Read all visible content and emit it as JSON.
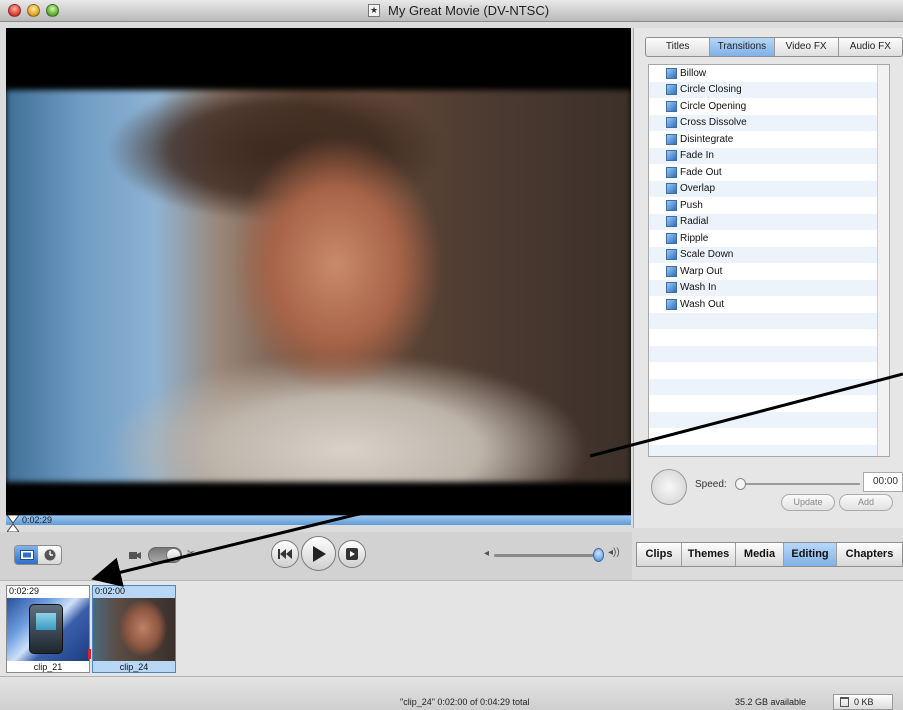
{
  "window": {
    "title": "My Great Movie (DV-NTSC)"
  },
  "viewer": {
    "playhead_time": "0:02:29"
  },
  "effects_panel": {
    "tabs": [
      {
        "label": "Titles",
        "selected": false
      },
      {
        "label": "Transitions",
        "selected": true
      },
      {
        "label": "Video FX",
        "selected": false
      },
      {
        "label": "Audio FX",
        "selected": false
      }
    ],
    "transitions": [
      "Billow",
      "Circle Closing",
      "Circle Opening",
      "Cross Dissolve",
      "Disintegrate",
      "Fade In",
      "Fade Out",
      "Overlap",
      "Push",
      "Radial",
      "Ripple",
      "Scale Down",
      "Warp Out",
      "Wash In",
      "Wash Out"
    ],
    "speed_label": "Speed:",
    "speed_value": "00:00",
    "update_label": "Update",
    "add_label": "Add"
  },
  "pane_tabs": [
    {
      "label": "Clips",
      "selected": false
    },
    {
      "label": "Themes",
      "selected": false
    },
    {
      "label": "Media",
      "selected": false
    },
    {
      "label": "Editing",
      "selected": true
    },
    {
      "label": "Chapters",
      "selected": false
    }
  ],
  "clips": [
    {
      "duration": "0:02:29",
      "name": "clip_21",
      "selected": false
    },
    {
      "duration": "0:02:00",
      "name": "clip_24",
      "selected": true
    }
  ],
  "status": {
    "selection": "\"clip_24\"  0:02:00 of 0:04:29 total",
    "disk_available": "35.2 GB available",
    "trash": "0 KB"
  },
  "colors": {
    "selection_blue": "#7fb1e8",
    "timeline_marker": "#e02020",
    "scrubber_blue": "#5e9bd6"
  },
  "icons": [
    "camera-icon",
    "scissors-icon",
    "rewind-icon",
    "play-icon",
    "fullscreen-icon",
    "volume-low-icon",
    "volume-high-icon",
    "trash-icon",
    "clip-view-icon",
    "timeline-view-icon"
  ]
}
